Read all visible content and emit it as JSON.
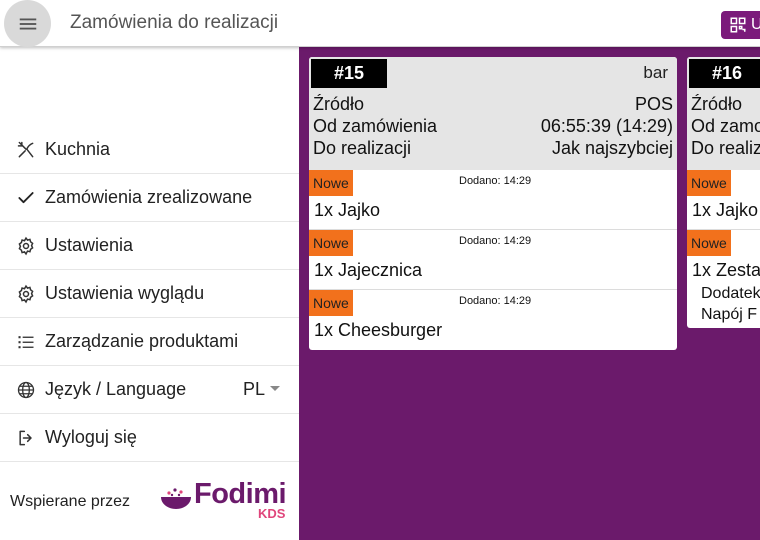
{
  "header": {
    "title": "Zamówienia do realizacji",
    "chip_label": "U"
  },
  "drawer": {
    "items": [
      {
        "label": "Kuchnia",
        "icon": "utensils-icon"
      },
      {
        "label": "Zamówienia zrealizowane",
        "icon": "check-icon"
      },
      {
        "label": "Ustawienia",
        "icon": "gear-icon"
      },
      {
        "label": "Ustawienia wyglądu",
        "icon": "gear-icon"
      },
      {
        "label": "Zarządzanie produktami",
        "icon": "list-icon"
      },
      {
        "label": "Język / Language",
        "icon": "globe-icon",
        "value": "PL"
      },
      {
        "label": "Wyloguj się",
        "icon": "logout-icon"
      }
    ],
    "powered_by": "Wspierane przez",
    "logo_word": "Fodimi",
    "logo_sub": "KDS"
  },
  "orders": [
    {
      "number": "#15",
      "station": "bar",
      "source_label": "Źródło",
      "source_value": "POS",
      "since_label": "Od zamówienia",
      "since_value": "06:55:39 (14:29)",
      "due_label": "Do realizacji",
      "due_value": "Jak najszybciej",
      "items": [
        {
          "status": "Nowe",
          "added": "Dodano: 14:29",
          "name": "1x Jajko"
        },
        {
          "status": "Nowe",
          "added": "Dodano: 14:29",
          "name": "1x Jajecznica"
        },
        {
          "status": "Nowe",
          "added": "Dodano: 14:29",
          "name": "1x Cheesburger"
        }
      ]
    },
    {
      "number": "#16",
      "station": "",
      "source_label": "Źródło",
      "since_label": "Od zamo",
      "due_label": "Do realiz",
      "items": [
        {
          "status": "Nowe",
          "name": "1x Jajko"
        },
        {
          "status": "Nowe",
          "name": "1x Zesta",
          "modifiers": [
            "Dodatek",
            "Napój F"
          ]
        }
      ]
    }
  ],
  "colors": {
    "background": "#6b1a6b",
    "new_badge": "#f2711c",
    "brand": "#6b1a6b",
    "brand_accent": "#e0457b"
  }
}
